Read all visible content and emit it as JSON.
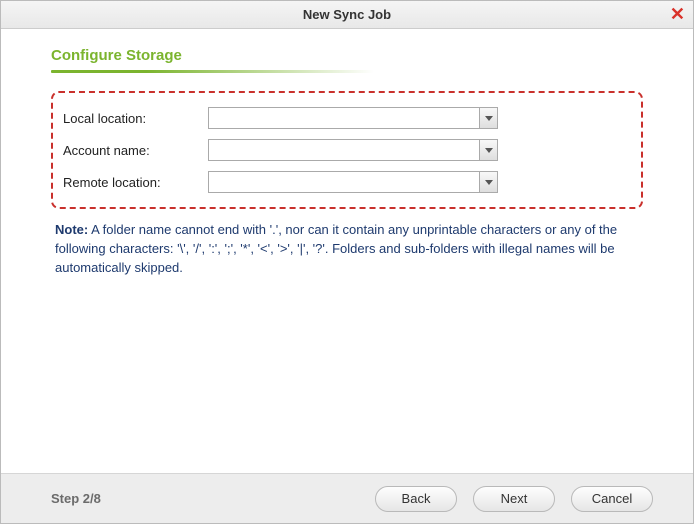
{
  "window": {
    "title": "New Sync Job"
  },
  "section": {
    "title": "Configure Storage"
  },
  "form": {
    "local_location": {
      "label": "Local location:",
      "value": ""
    },
    "account_name": {
      "label": "Account name:",
      "value": ""
    },
    "remote_location": {
      "label": "Remote location:",
      "value": ""
    }
  },
  "note": {
    "label": "Note:",
    "text": " A folder name cannot end with '.', nor can it contain any unprintable characters or any of the following characters: '\\', '/', ':', ';', '*', '<', '>', '|', '?'. Folders and sub-folders with illegal names will be automatically skipped."
  },
  "footer": {
    "step": "Step 2/8",
    "back": "Back",
    "next": "Next",
    "cancel": "Cancel"
  }
}
